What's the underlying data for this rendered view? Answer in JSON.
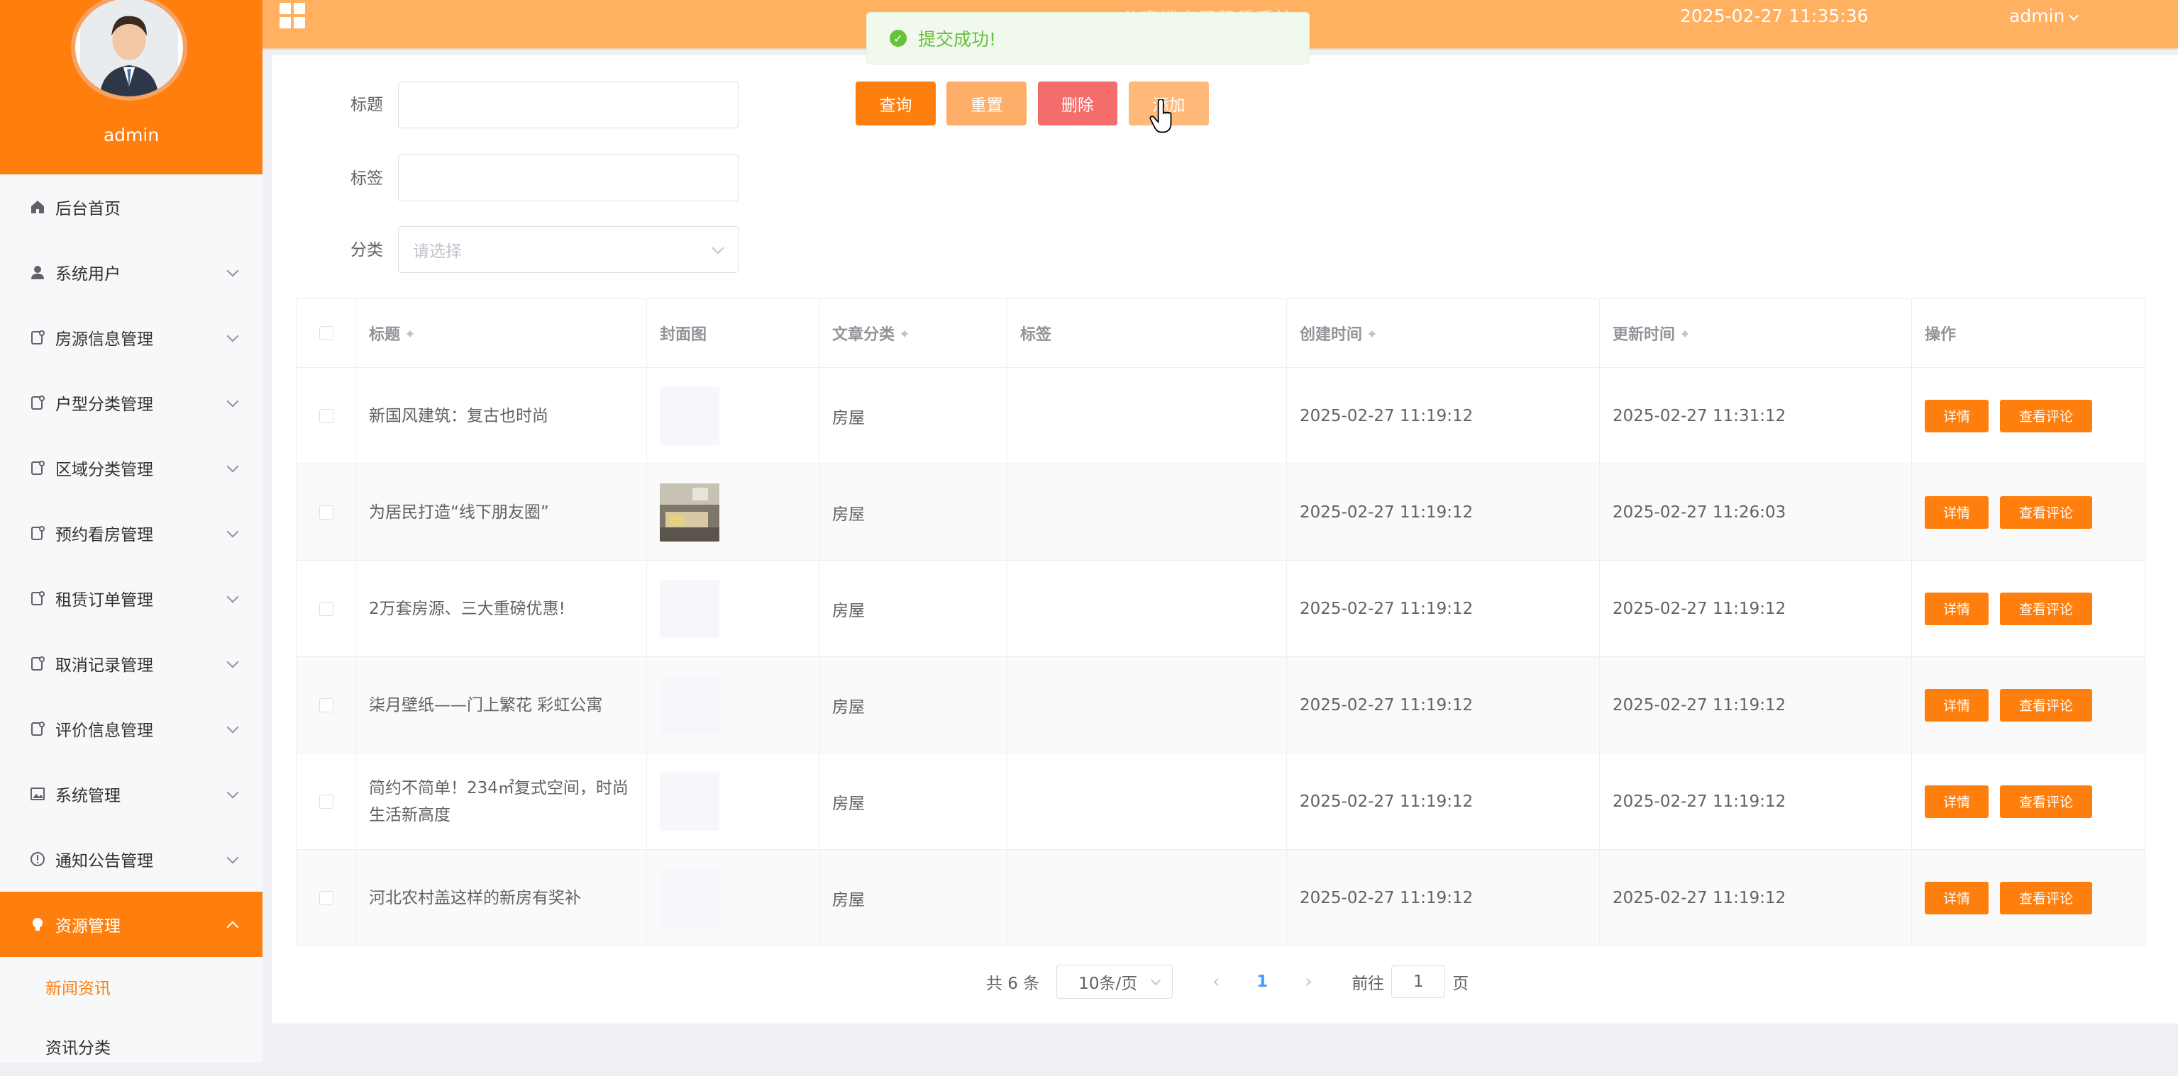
{
  "sidebar": {
    "username": "admin",
    "menu": [
      {
        "label": "后台首页",
        "icon": "home-icon"
      },
      {
        "label": "系统用户",
        "icon": "user-icon"
      },
      {
        "label": "房源信息管理",
        "icon": "document-icon"
      },
      {
        "label": "户型分类管理",
        "icon": "document-icon"
      },
      {
        "label": "区域分类管理",
        "icon": "document-icon"
      },
      {
        "label": "预约看房管理",
        "icon": "document-icon"
      },
      {
        "label": "租赁订单管理",
        "icon": "document-icon"
      },
      {
        "label": "取消记录管理",
        "icon": "document-icon"
      },
      {
        "label": "评价信息管理",
        "icon": "document-icon"
      },
      {
        "label": "系统管理",
        "icon": "picture-icon"
      },
      {
        "label": "通知公告管理",
        "icon": "info-icon"
      },
      {
        "label": "资源管理",
        "icon": "bulb-icon"
      }
    ],
    "sub_items": [
      "新闻资讯",
      "资讯分类"
    ]
  },
  "topbar": {
    "title": "公寓楼房屋租赁系统",
    "datetime": "2025-02-27 11:35:36",
    "user": "admin"
  },
  "toast": {
    "message": "提交成功!"
  },
  "search": {
    "title_label": "标题",
    "tag_label": "标签",
    "category_label": "分类",
    "category_placeholder": "请选择",
    "buttons": {
      "query": "查询",
      "reset": "重置",
      "delete": "删除",
      "add": "添加"
    }
  },
  "colors": {
    "accent": "#ff7f0e",
    "topbar": "#ffb060",
    "reset": "#ffae6a",
    "delete": "#f56c6c",
    "success": "#67c23a"
  },
  "table": {
    "headers": [
      "标题",
      "封面图",
      "文章分类",
      "标签",
      "创建时间",
      "更新时间",
      "操作"
    ],
    "rows": [
      {
        "title": "新国风建筑：复古也时尚",
        "category": "房屋",
        "tag": "",
        "created": "2025-02-27 11:19:12",
        "updated": "2025-02-27 11:31:12"
      },
      {
        "title": "为居民打造“线下朋友圈”",
        "category": "房屋",
        "tag": "",
        "created": "2025-02-27 11:19:12",
        "updated": "2025-02-27 11:26:03"
      },
      {
        "title": "2万套房源、三大重磅优惠!",
        "category": "房屋",
        "tag": "",
        "created": "2025-02-27 11:19:12",
        "updated": "2025-02-27 11:19:12"
      },
      {
        "title": "柒月壁纸——门上繁花 彩虹公寓",
        "category": "房屋",
        "tag": "",
        "created": "2025-02-27 11:19:12",
        "updated": "2025-02-27 11:19:12"
      },
      {
        "title": "简约不简单！234㎡复式空间，时尚生活新高度",
        "category": "房屋",
        "tag": "",
        "created": "2025-02-27 11:19:12",
        "updated": "2025-02-27 11:19:12"
      },
      {
        "title": "河北农村盖这样的新房有奖补",
        "category": "房屋",
        "tag": "",
        "created": "2025-02-27 11:19:12",
        "updated": "2025-02-27 11:19:12"
      }
    ],
    "op_detail": "详情",
    "op_comment": "查看评论"
  },
  "pagination": {
    "total": "共 6 条",
    "page_size": "10条/页",
    "current_page": "1",
    "goto_prefix": "前往",
    "goto_value": "1",
    "goto_suffix": "页"
  }
}
